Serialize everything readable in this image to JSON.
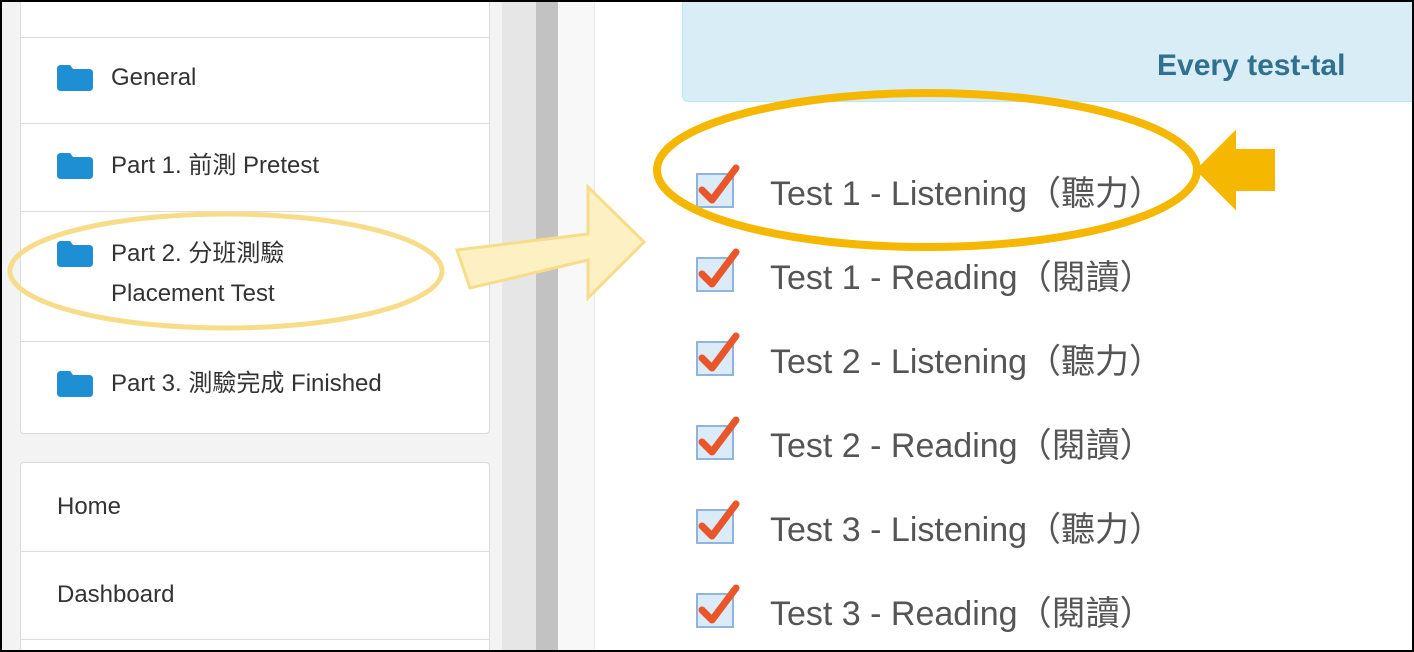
{
  "course_sections": [
    {
      "label": "General"
    },
    {
      "label": "Part 1. 前測 Pretest"
    },
    {
      "label_line1": "Part 2. 分班測驗",
      "label_line2": "Placement Test"
    },
    {
      "label": "Part 3. 測驗完成 Finished"
    }
  ],
  "navigation": [
    {
      "label": "Home"
    },
    {
      "label": "Dashboard"
    }
  ],
  "notice": {
    "text": "Every test-tal"
  },
  "activities": [
    {
      "label": "Test 1 - Listening（聽力）"
    },
    {
      "label": "Test 1 - Reading（閱讀）"
    },
    {
      "label": "Test 2 - Listening（聽力）"
    },
    {
      "label": "Test 2 - Reading（閱讀）"
    },
    {
      "label": "Test 3 - Listening（聽力）"
    },
    {
      "label": "Test 3 - Reading（閱讀）"
    }
  ],
  "colors": {
    "folder": "#1f8fd4",
    "checkbox_fill": "#dcebf8",
    "checkmark": "#e8562a",
    "highlight_ellipse": "#f6b700",
    "highlight_soft": "#f7dd8a",
    "info_text": "#31708f"
  }
}
